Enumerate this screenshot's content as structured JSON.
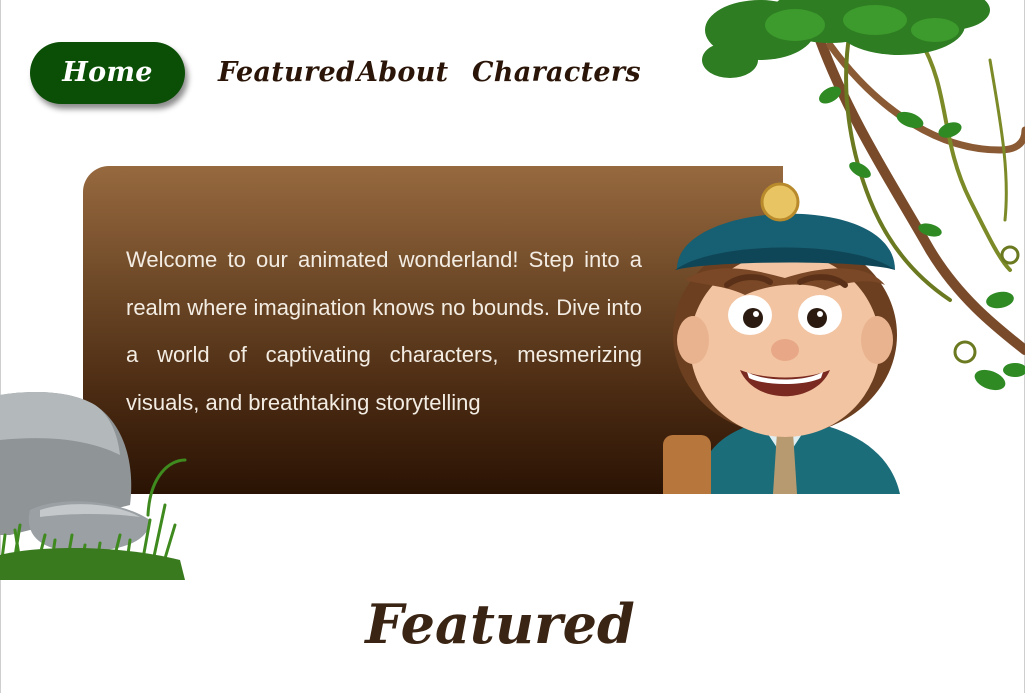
{
  "nav": {
    "items": [
      {
        "label": "Home",
        "active": true
      },
      {
        "label": "Featured",
        "active": false
      },
      {
        "label": "About",
        "active": false
      },
      {
        "label": "Characters",
        "active": false
      }
    ]
  },
  "hero": {
    "text": "Welcome to our animated wonderland! Step into a realm where imagination knows no bounds. Dive into a world of captivating characters, mesmerizing visuals, and breathtaking storytelling"
  },
  "featured": {
    "title": "Featured"
  },
  "colors": {
    "nav_active_bg": "#0b4f06",
    "nav_text": "#2a1508",
    "hero_gradient_top": "#97693f",
    "hero_gradient_bottom": "#2a1304",
    "heading": "#3a2413"
  },
  "decorations": {
    "vines": "jungle-vines-illustration",
    "character": "cartoon-boy-with-cap-illustration",
    "rock": "rock-and-grass-illustration"
  }
}
